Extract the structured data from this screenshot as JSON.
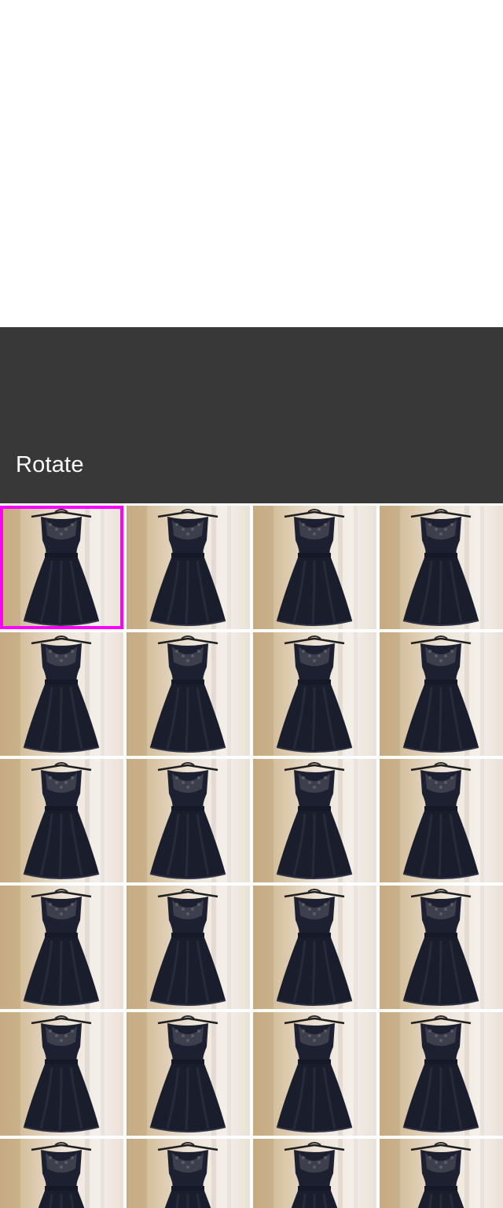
{
  "header": {
    "title": "Rotate"
  },
  "thumbnails": {
    "count": 24,
    "columns": 4,
    "selected_index": 0,
    "subject_icon": "dress-photo-icon",
    "selection_color": "#ff00ff"
  },
  "colors": {
    "header_background": "#383838",
    "header_text": "#ffffff",
    "page_background": "#ffffff"
  }
}
